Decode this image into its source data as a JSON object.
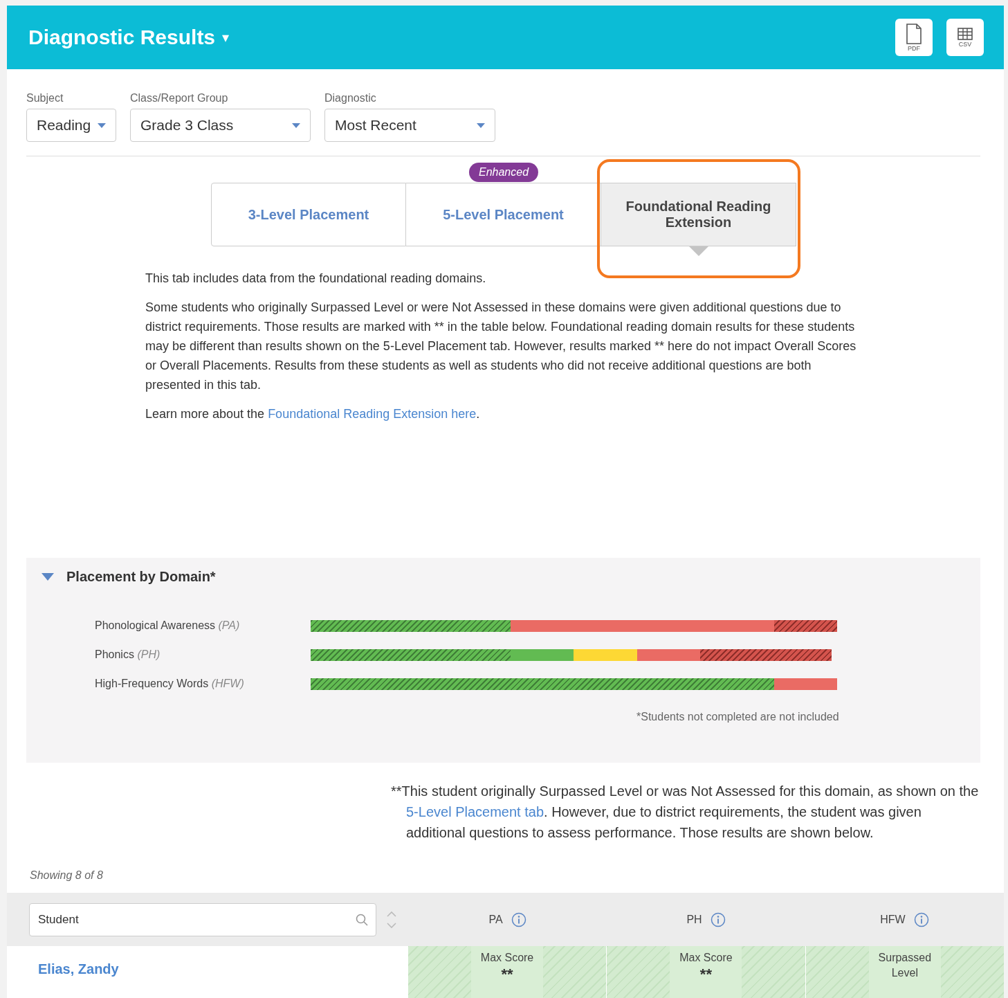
{
  "header": {
    "title": "Diagnostic Results",
    "caret": "▾",
    "exports": [
      {
        "kind": "pdf",
        "label": "PDF"
      },
      {
        "kind": "csv",
        "label": "CSV"
      }
    ]
  },
  "filters": [
    {
      "label": "Subject",
      "value": "Reading"
    },
    {
      "label": "Class/Report Group",
      "value": "Grade 3 Class"
    },
    {
      "label": "Diagnostic",
      "value": "Most Recent"
    }
  ],
  "tabs": [
    {
      "label": "3-Level Placement",
      "selected": false
    },
    {
      "label": "5-Level Placement",
      "selected": false,
      "badge": "Enhanced"
    },
    {
      "label": "Foundational Reading Extension",
      "selected": true,
      "highlighted": true
    }
  ],
  "intro": [
    "This tab includes data from the foundational reading domains.",
    "Some students who originally Surpassed Level or were Not Assessed in these domains were given additional questions due to district requirements. Those results are marked with ** in the table below. Foundational reading domain results for these students may be different than results shown on the 5-Level Placement tab. However, results marked ** here do not impact Overall Scores or Overall Placements. Results from these students as well as students who did not receive additional questions are both presented in this tab."
  ],
  "learn_more": {
    "text": "Learn more about the ",
    "link": "Foundational Reading Extension here",
    "after": "."
  },
  "placement": {
    "title": "Placement by Domain*",
    "expanded": true,
    "domains": [
      {
        "name": "Phonological Awareness",
        "abbr": "(PA)",
        "segments": [
          {
            "kind": "green-hatched"
          },
          {
            "kind": "red"
          },
          {
            "kind": "red-hatched"
          }
        ]
      },
      {
        "name": "Phonics",
        "abbr": "(PH)",
        "segments": [
          {
            "kind": "green-hatched"
          },
          {
            "kind": "green"
          },
          {
            "kind": "yellow"
          },
          {
            "kind": "red"
          },
          {
            "kind": "red-hatched"
          }
        ]
      },
      {
        "name": "High-Frequency Words",
        "abbr": "(HFW)",
        "segments": [
          {
            "kind": "green-hatched"
          },
          {
            "kind": "red"
          }
        ]
      }
    ],
    "note": "*Students not completed are not included"
  },
  "footnote": {
    "before": "**This student originally Surpassed Level or was Not Assessed for this domain, as shown on the ",
    "link": "5-Level Placement tab",
    "after": ". However, due to district requirements, the student was given additional questions to assess performance. Those results are shown below."
  },
  "showing": "Showing 8 of 8",
  "table": {
    "search": {
      "placeholder": "Student"
    },
    "columns": [
      "PA",
      "PH",
      "HFW"
    ],
    "rows": [
      {
        "student": "Elias, Zandy",
        "cells": [
          [
            "Max Score",
            "**"
          ],
          [
            "Max Score",
            "**"
          ],
          [
            "Surpassed Level"
          ]
        ]
      }
    ]
  }
}
